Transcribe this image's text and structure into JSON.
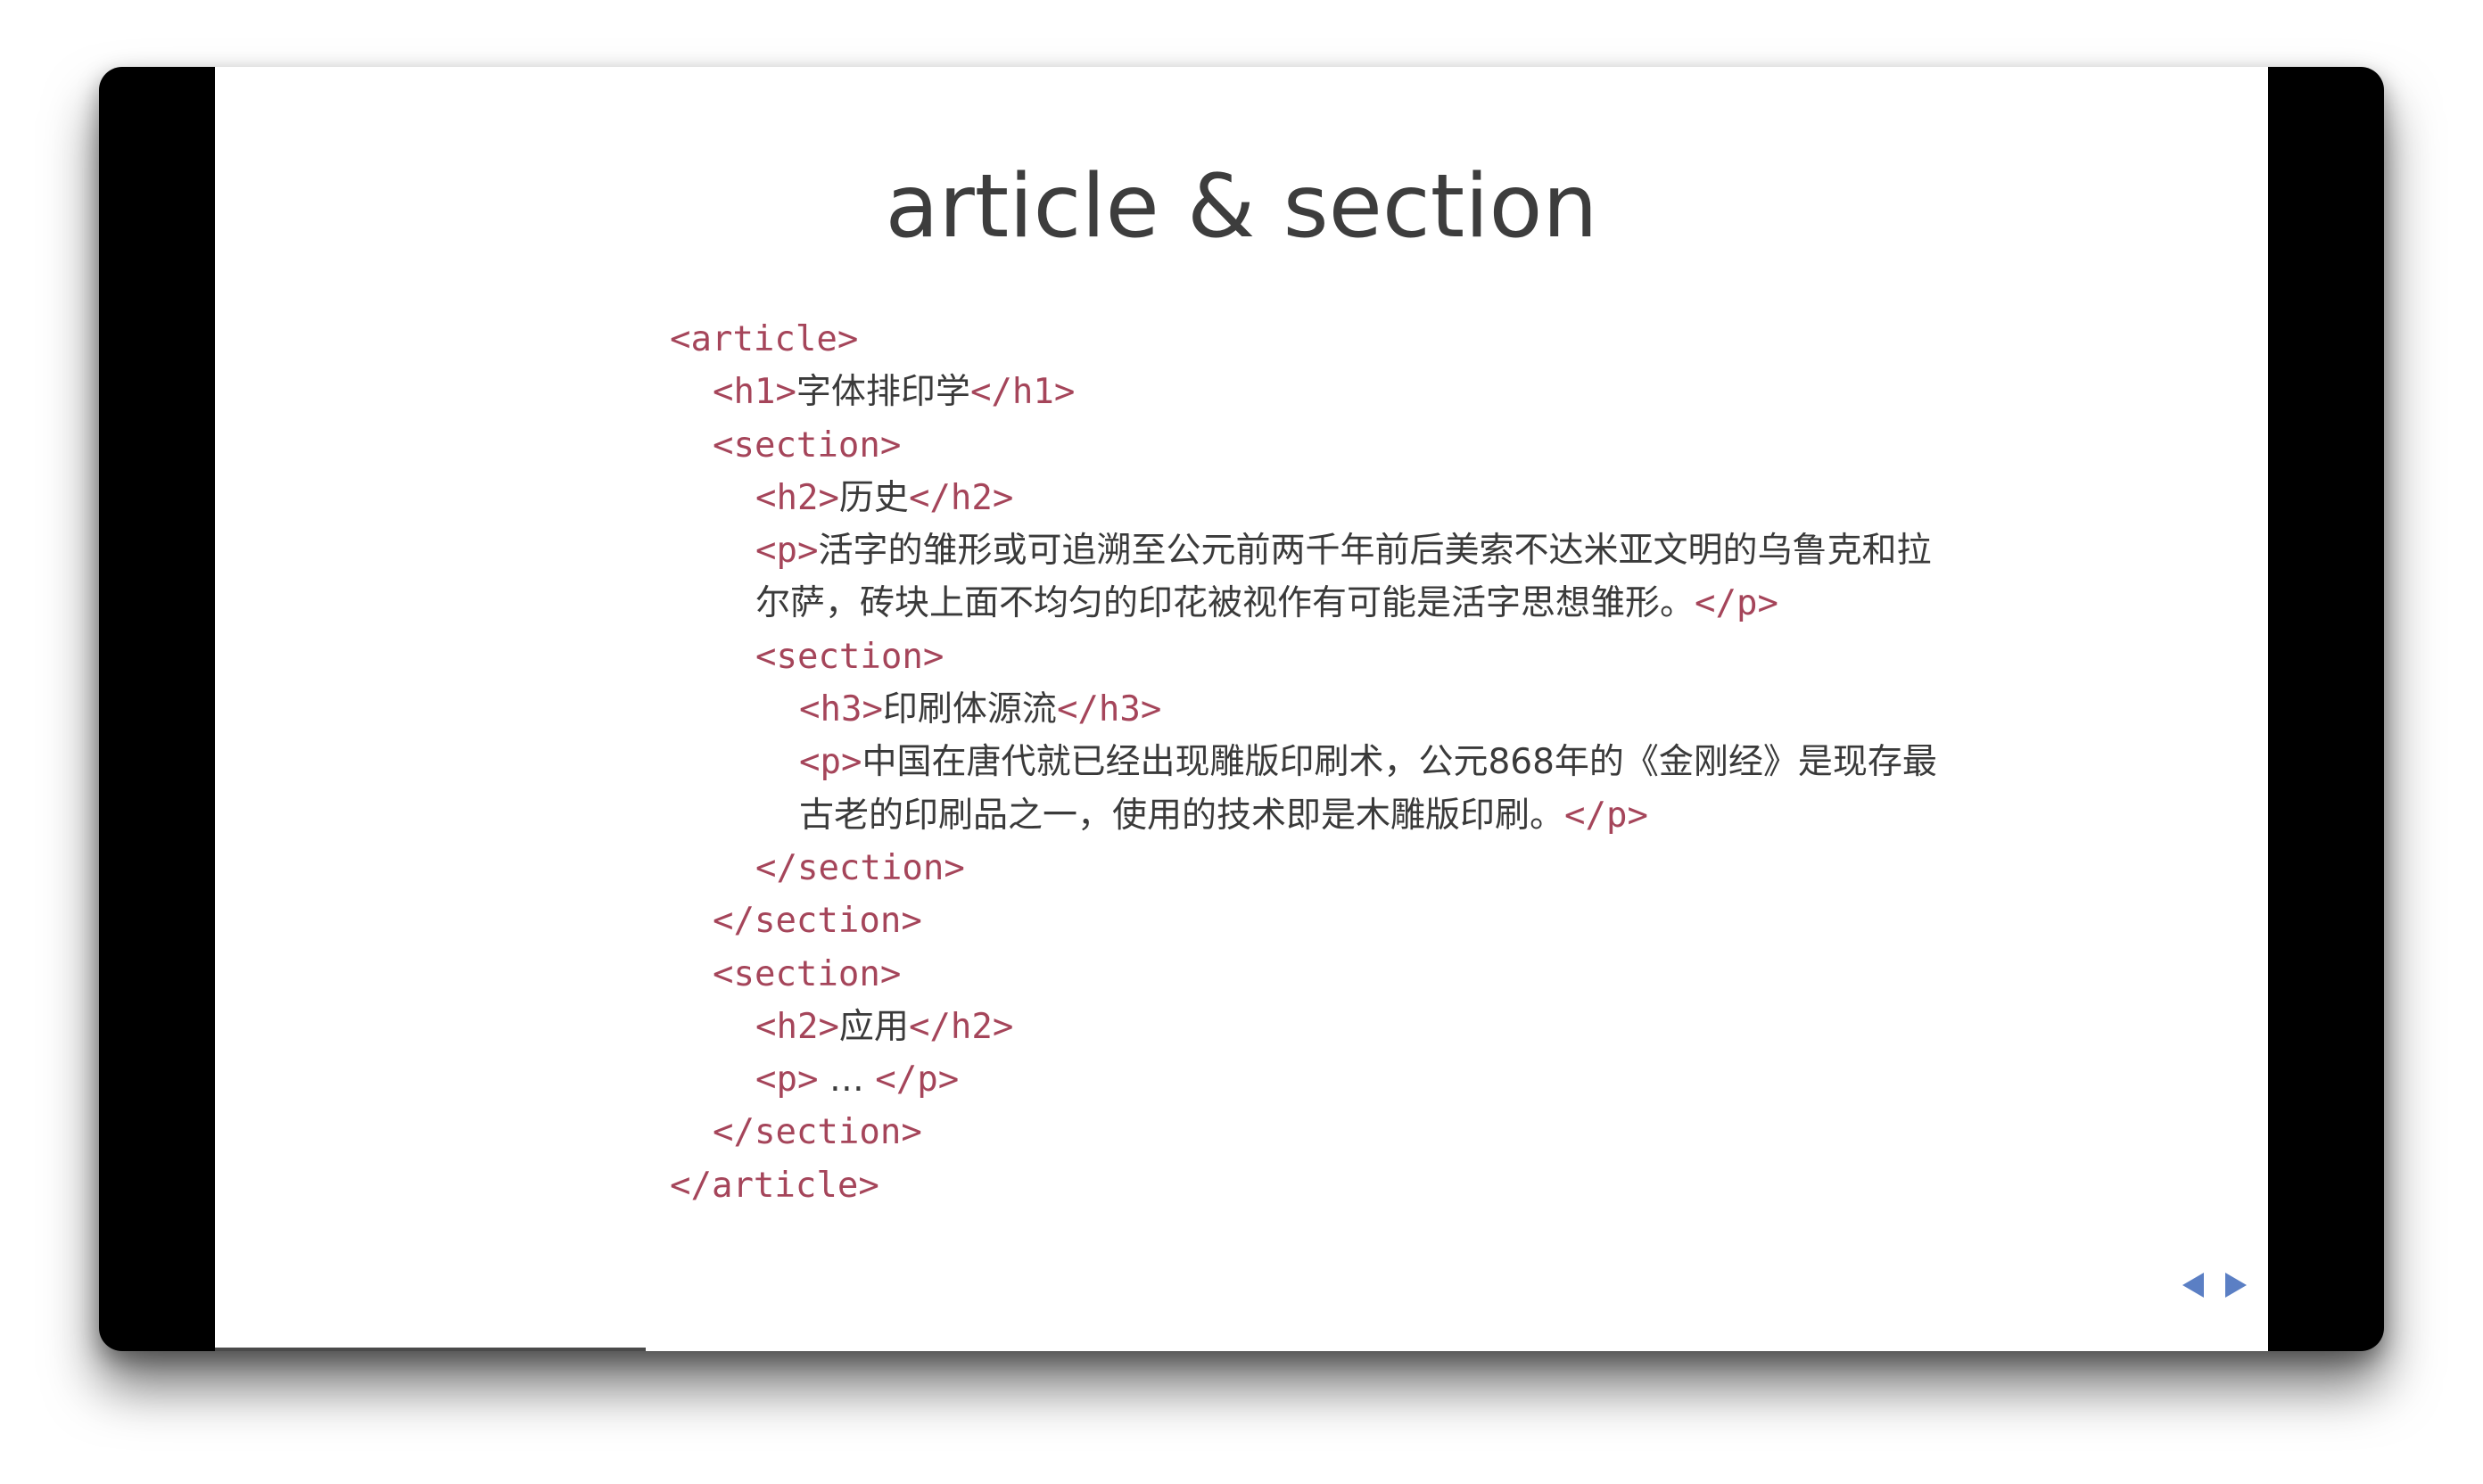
{
  "slide": {
    "title": "article & section",
    "nav": {
      "prev_icon": "triangle-left-icon",
      "next_icon": "triangle-right-icon",
      "color": "#5b7fc4"
    },
    "progress_fraction": 0.21
  },
  "colors": {
    "tag": "#a5455a",
    "text": "#3a3a3a",
    "title": "#3d3d3d",
    "nav": "#5b7fc4"
  },
  "code": {
    "article_open": "<article>",
    "h1_open": "<h1>",
    "h1_text": "字体排印学",
    "h1_close": "</h1>",
    "section1_open": "<section>",
    "h2a_open": "<h2>",
    "h2a_text": "历史",
    "h2a_close": "</h2>",
    "p1_open": "<p>",
    "p1_text": "活字的雏形或可追溯至公元前两千年前后美索不达米亚文明的乌鲁克和拉尔萨，砖块上面不均匀的印花被视作有可能是活字思想雏形。",
    "p1_close": "</p>",
    "section2_open": "<section>",
    "h3_open": "<h3>",
    "h3_text": "印刷体源流",
    "h3_close": "</h3>",
    "p2_open": "<p>",
    "p2_text": "中国在唐代就已经出现雕版印刷术，公元868年的《金刚经》是现存最古老的印刷品之一，使用的技术即是木雕版印刷。",
    "p2_close": "</p>",
    "section2_close": "</section>",
    "section1_close": "</section>",
    "section3_open": "<section>",
    "h2b_open": "<h2>",
    "h2b_text": "应用",
    "h2b_close": "</h2>",
    "p3_open": "<p>",
    "p3_text": " … ",
    "p3_close": "</p>",
    "section3_close": "</section>",
    "article_close": "</article>"
  }
}
